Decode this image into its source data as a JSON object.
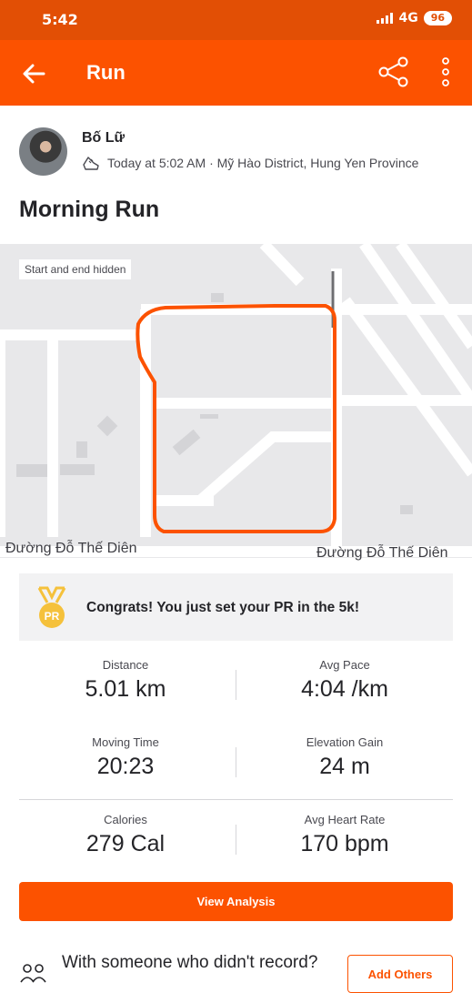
{
  "status_bar": {
    "time": "5:42",
    "network": "4G",
    "battery": "96"
  },
  "app_bar": {
    "title": "Run",
    "back_icon": "arrow-left-icon",
    "share_icon": "share-icon",
    "more_icon": "more-vertical-icon"
  },
  "athlete": {
    "name": "Bố Lữ",
    "meta": "Today at 5:02 AM · Mỹ Hào District, Hung Yen Province",
    "activity_icon": "shoe-icon"
  },
  "activity": {
    "title": "Morning Run"
  },
  "map": {
    "badge": "Start and end hidden",
    "street_left": "Đường Đỗ Thế Diên",
    "street_right": "Đường Đỗ Thế Diên",
    "route_color": "#fc5200"
  },
  "pr": {
    "text": "Congrats! You just set your PR in the 5k!",
    "medal_label": "PR",
    "medal_color": "#f5c13b"
  },
  "stats": [
    {
      "label": "Distance",
      "value": "5.01 km"
    },
    {
      "label": "Avg Pace",
      "value": "4:04 /km"
    },
    {
      "label": "Moving Time",
      "value": "20:23"
    },
    {
      "label": "Elevation Gain",
      "value": "24 m"
    },
    {
      "label": "Calories",
      "value": "279 Cal"
    },
    {
      "label": "Avg Heart Rate",
      "value": "170 bpm"
    }
  ],
  "actions": {
    "view_analysis": "View Analysis",
    "with_someone": "With someone who didn't record?",
    "add_others": "Add Others"
  },
  "colors": {
    "brand": "#fc5200",
    "status_bar": "#e24f05"
  }
}
